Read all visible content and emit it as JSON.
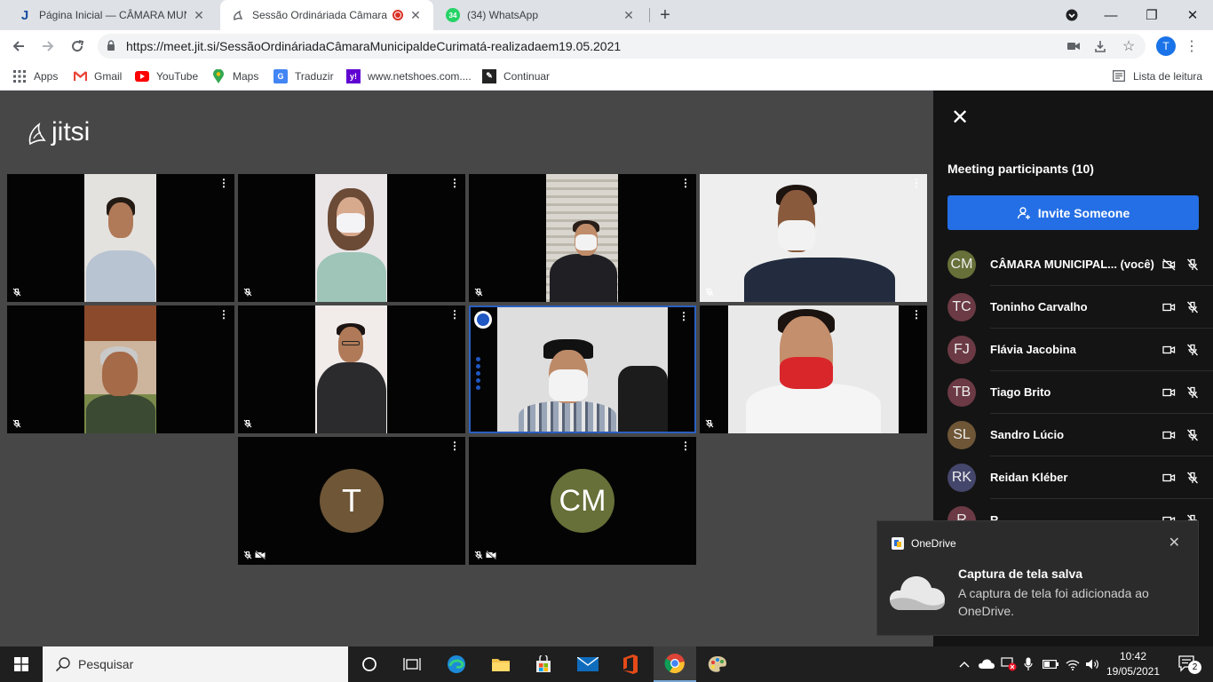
{
  "browser": {
    "tabs": [
      {
        "title": "Página Inicial — CÂMARA MUNICIPAL DE CURIMATÁ",
        "icon": "jitsi-j-icon",
        "active": false
      },
      {
        "title": "Sessão Ordináriada Câmara Municipal",
        "icon": "jitsi-icon",
        "active": true,
        "recording": true
      },
      {
        "title": "(34) WhatsApp",
        "icon": "whatsapp-icon",
        "badge": "34",
        "active": false
      }
    ],
    "new_tab": "+",
    "url": "https://meet.jit.si/SessãoOrdináriadaCâmaraMunicipaldeCurimatá-realizadaem19.05.2021",
    "profile_initial": "T",
    "bookmarks": [
      {
        "label": "Apps",
        "icon": "apps-grid-icon"
      },
      {
        "label": "Gmail",
        "icon": "gmail-icon"
      },
      {
        "label": "YouTube",
        "icon": "youtube-icon"
      },
      {
        "label": "Maps",
        "icon": "maps-pin-icon"
      },
      {
        "label": "Traduzir",
        "icon": "translate-icon"
      },
      {
        "label": "www.netshoes.com....",
        "icon": "yahoo-icon"
      },
      {
        "label": "Continuar",
        "icon": "continue-icon"
      }
    ],
    "reading_list": "Lista de leitura"
  },
  "jitsi": {
    "logo_text": "jitsi",
    "tiles": [
      {
        "type": "video",
        "muted": true
      },
      {
        "type": "video",
        "muted": true
      },
      {
        "type": "video",
        "muted": true
      },
      {
        "type": "video",
        "muted": true
      },
      {
        "type": "video",
        "muted": true
      },
      {
        "type": "video",
        "muted": true
      },
      {
        "type": "video",
        "muted": false,
        "dominant": true
      },
      {
        "type": "video",
        "muted": true
      },
      {
        "type": "avatar",
        "initials": "T",
        "color": "#6e5637",
        "muted": true,
        "camera_off": true
      },
      {
        "type": "avatar",
        "initials": "CM",
        "color": "#667038",
        "muted": true,
        "camera_off": true
      }
    ]
  },
  "participants": {
    "title": "Meeting participants (10)",
    "invite_label": "Invite Someone",
    "list": [
      {
        "initials": "CM",
        "name": "CÂMARA MUNICIPAL... (você)",
        "color": "#667038",
        "camera_off": true,
        "muted": true
      },
      {
        "initials": "TC",
        "name": "Toninho Carvalho",
        "color": "#6b3a44",
        "camera_off": false,
        "muted": true
      },
      {
        "initials": "FJ",
        "name": "Flávia Jacobina",
        "color": "#6b3a44",
        "camera_off": false,
        "muted": true
      },
      {
        "initials": "TB",
        "name": "Tiago Brito",
        "color": "#6b3a44",
        "camera_off": false,
        "muted": true
      },
      {
        "initials": "SL",
        "name": "Sandro Lúcio",
        "color": "#6e5637",
        "camera_off": false,
        "muted": true
      },
      {
        "initials": "RK",
        "name": "Reidan Kléber",
        "color": "#45466b",
        "camera_off": false,
        "muted": true
      },
      {
        "initials": "R",
        "name": "R",
        "color": "#6b3a44",
        "camera_off": false,
        "muted": true
      }
    ]
  },
  "toast": {
    "app": "OneDrive",
    "title": "Captura de tela salva",
    "message": "A captura de tela foi adicionada ao OneDrive."
  },
  "taskbar": {
    "search_placeholder": "Pesquisar",
    "time": "10:42",
    "date": "19/05/2021",
    "notifications": "2"
  }
}
